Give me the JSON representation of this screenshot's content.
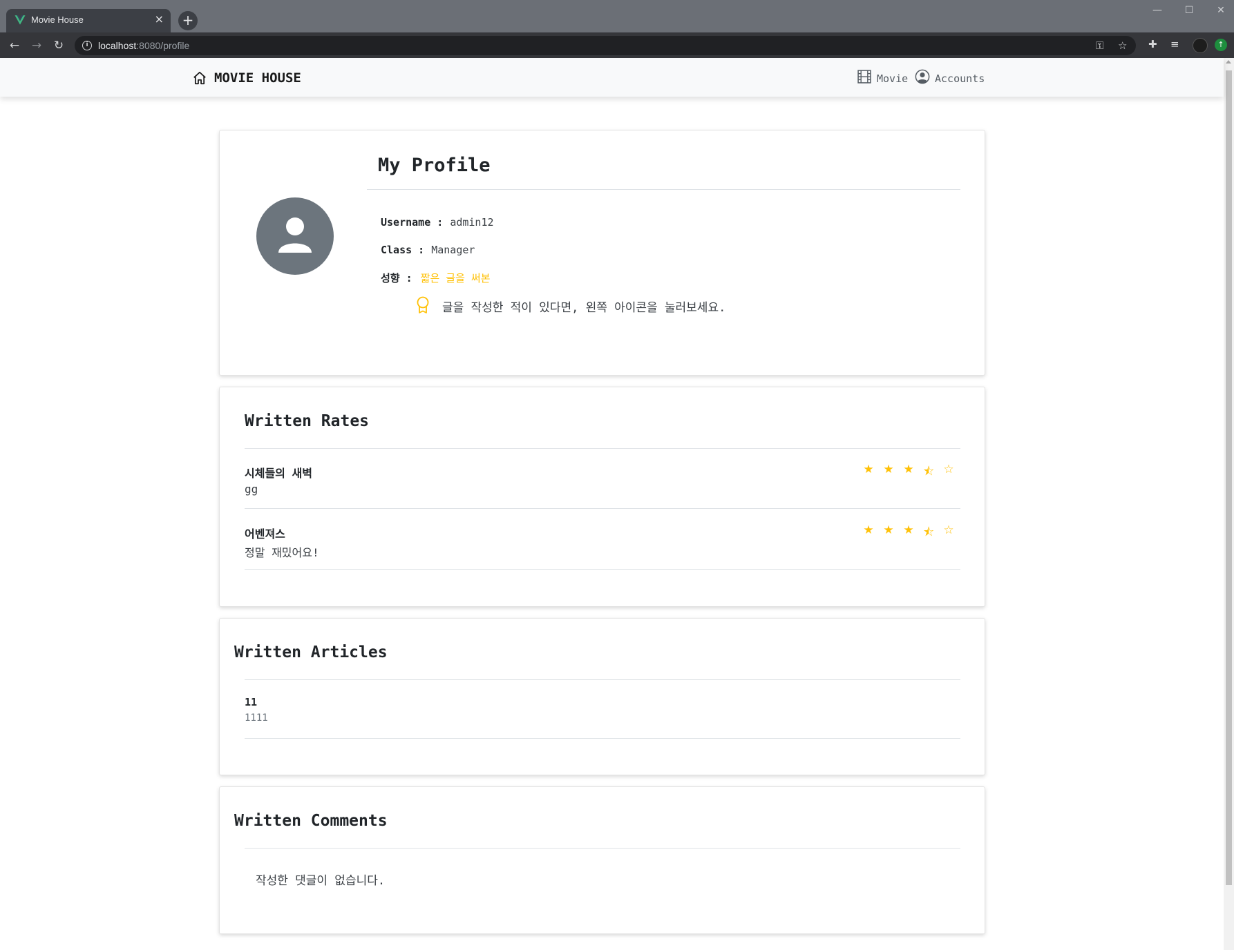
{
  "browser": {
    "tab_title": "Movie House",
    "tab_close": "×",
    "new_tab": "+",
    "url_host": "localhost",
    "url_path": ":8080/profile",
    "window_controls": {
      "minimize": "—",
      "maximize": "☐",
      "close": "✕"
    }
  },
  "navbar": {
    "brand": "MOVIE HOUSE",
    "links": [
      {
        "label": "Movie",
        "icon": "film-icon"
      },
      {
        "label": "Accounts",
        "icon": "person-circle-icon"
      }
    ]
  },
  "profile": {
    "title": "My Profile",
    "avatar_icon": "person-icon",
    "username_label": "Username :",
    "username": "admin12",
    "class_label": "Class :",
    "class": "Manager",
    "tendency_label": "성향 :",
    "tendency": "짧은 글을 써본",
    "hint_icon": "award-icon",
    "hint": "글을 작성한 적이 있다면, 왼쪽 아이콘을 눌러보세요."
  },
  "rates": {
    "title": "Written Rates",
    "items": [
      {
        "movie": "시체들의 새벽",
        "comment": "gg",
        "rating": 3.5,
        "max": 5
      },
      {
        "movie": "어벤져스",
        "comment": "정말 재밌어요!",
        "rating": 3.5,
        "max": 5
      }
    ]
  },
  "articles": {
    "title": "Written Articles",
    "items": [
      {
        "title": "11",
        "body": "1111"
      }
    ]
  },
  "comments": {
    "title": "Written Comments",
    "empty": "작성한 댓글이 없습니다."
  },
  "colors": {
    "accent": "#ffc107",
    "avatar_bg": "#6c757d",
    "navbar_bg": "#f8f9fa"
  }
}
